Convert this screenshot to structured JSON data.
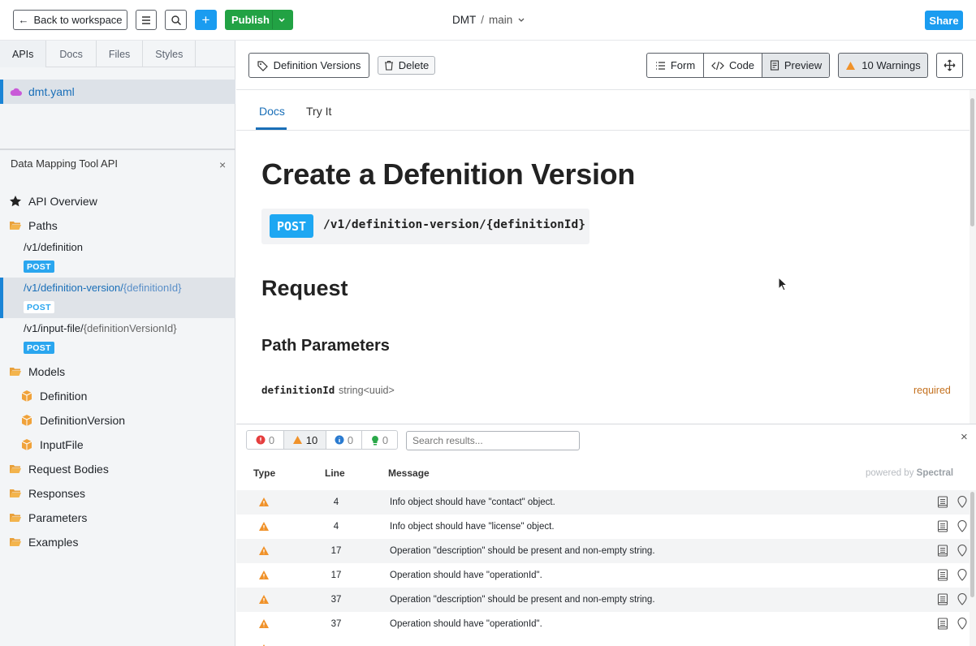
{
  "topbar": {
    "back_label": "Back to workspace",
    "publish_label": "Publish",
    "project": "DMT",
    "separator": "/",
    "branch": "main",
    "share_label": "Share"
  },
  "sidebar": {
    "tabs": [
      "APIs",
      "Docs",
      "Files",
      "Styles"
    ],
    "file_name": "dmt.yaml",
    "api_title": "Data Mapping Tool API",
    "overview": "API Overview",
    "paths_label": "Paths",
    "paths": [
      {
        "base": "/v1/definition",
        "param": "",
        "method": "POST"
      },
      {
        "base": "/v1/definition-version/",
        "param": "{definitionId}",
        "method": "POST"
      },
      {
        "base": "/v1/input-file/",
        "param": "{definitionVersionId}",
        "method": "POST"
      }
    ],
    "models_label": "Models",
    "models": [
      "Definition",
      "DefinitionVersion",
      "InputFile"
    ],
    "folders": [
      "Request Bodies",
      "Responses",
      "Parameters",
      "Examples"
    ]
  },
  "toolbar": {
    "definition_versions": "Definition Versions",
    "delete": "Delete",
    "form": "Form",
    "code": "Code",
    "preview": "Preview",
    "warnings": "10 Warnings"
  },
  "doc": {
    "tabs": [
      "Docs",
      "Try It"
    ],
    "title": "Create a Defenition Version",
    "method": "POST",
    "endpoint": "/v1/definition-version/{definitionId}",
    "request_heading": "Request",
    "path_params_heading": "Path Parameters",
    "param_name": "definitionId",
    "param_type": "string<uuid>",
    "required": "required"
  },
  "panel": {
    "counts": {
      "errors": "0",
      "warnings": "10",
      "info": "0",
      "hints": "0"
    },
    "search_placeholder": "Search results...",
    "col_type": "Type",
    "col_line": "Line",
    "col_message": "Message",
    "powered_by": "powered by",
    "powered_brand": "Spectral",
    "rows": [
      {
        "line": "4",
        "message": "Info object should have \"contact\" object."
      },
      {
        "line": "4",
        "message": "Info object should have \"license\" object."
      },
      {
        "line": "17",
        "message": "Operation \"description\" should be present and non-empty string."
      },
      {
        "line": "17",
        "message": "Operation should have \"operationId\"."
      },
      {
        "line": "37",
        "message": "Operation \"description\" should be present and non-empty string."
      },
      {
        "line": "37",
        "message": "Operation should have \"operationId\"."
      }
    ]
  },
  "colors": {
    "accent": "#0a84d6",
    "publish_green": "#22a244",
    "share_blue": "#1a9cf0",
    "warning_orange": "#f0922a",
    "post_blue": "#1ea7f2"
  }
}
